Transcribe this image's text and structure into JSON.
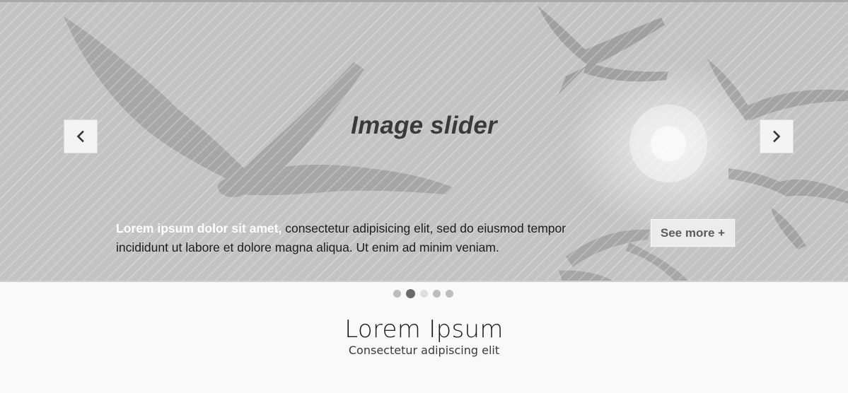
{
  "slider": {
    "title": "Image slider",
    "caption_lead": "Lorem ipsum dolor sit amet,",
    "caption_body": " consectetur adipisicing elit, sed do eiusmod tempor incididunt ut labore et dolore magna aliqua. Ut enim ad minim veniam.",
    "see_more_label": "See more +",
    "prev_icon": "chevron-left-icon",
    "next_icon": "chevron-right-icon",
    "dots_total": 5,
    "active_dot": 2
  },
  "content": {
    "heading": "Lorem Ipsum",
    "subheading": "Consectetur adipiscing elit"
  },
  "colors": {
    "title": "#3a3a3a",
    "caption_lead": "#ffffff",
    "button_bg": "#f4f4f4",
    "dot_active": "#6b6b6b",
    "dot_inactive": "#bdbdbd"
  }
}
